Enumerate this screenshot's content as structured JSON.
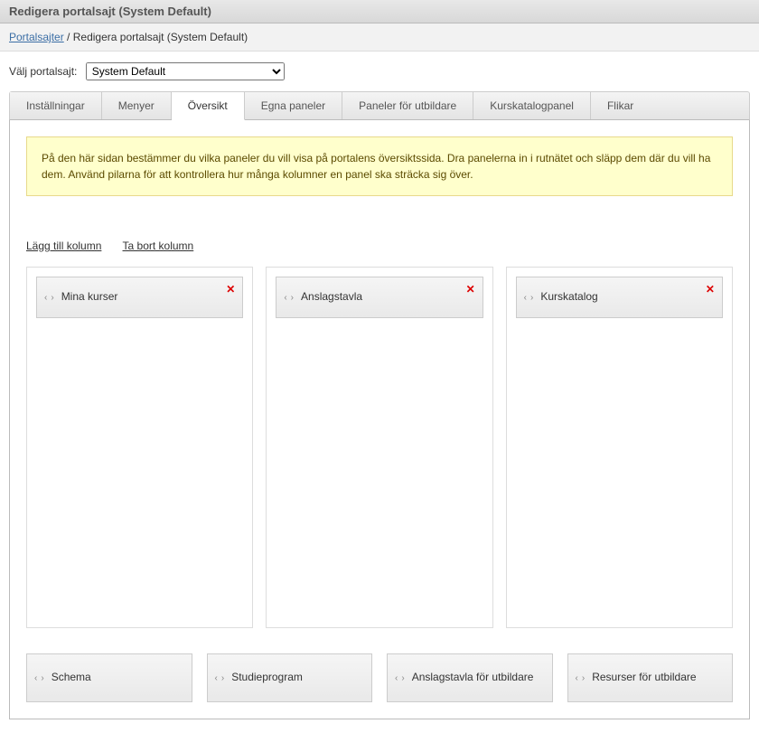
{
  "header": {
    "title": "Redigera portalsajt (System Default)"
  },
  "breadcrumb": {
    "link": "Portalsajter",
    "sep": "/",
    "current": "Redigera portalsajt (System Default)"
  },
  "selector": {
    "label": "Välj portalsajt:",
    "value": "System Default"
  },
  "tabs": {
    "installningar": "Inställningar",
    "menyer": "Menyer",
    "oversikt": "Översikt",
    "egna_paneler": "Egna paneler",
    "paneler_utbildare": "Paneler för utbildare",
    "kurskatalogpanel": "Kurskatalogpanel",
    "flikar": "Flikar"
  },
  "help": "På den här sidan bestämmer du vilka paneler du vill visa på portalens översiktssida. Dra panelerna in i rutnätet och släpp dem där du vill ha dem. Använd pilarna för att kontrollera hur många kolumner en panel ska sträcka sig över.",
  "actions": {
    "add_column": "Lägg till kolumn",
    "remove_column": "Ta bort kolumn"
  },
  "columns": [
    {
      "label": "Mina kurser"
    },
    {
      "label": "Anslagstavla"
    },
    {
      "label": "Kurskatalog"
    }
  ],
  "available": [
    {
      "label": "Schema"
    },
    {
      "label": "Studieprogram"
    },
    {
      "label": "Anslagstavla för utbildare"
    },
    {
      "label": "Resurser för utbildare"
    }
  ],
  "glyphs": {
    "left": "‹",
    "right": "›",
    "close": "✕"
  }
}
